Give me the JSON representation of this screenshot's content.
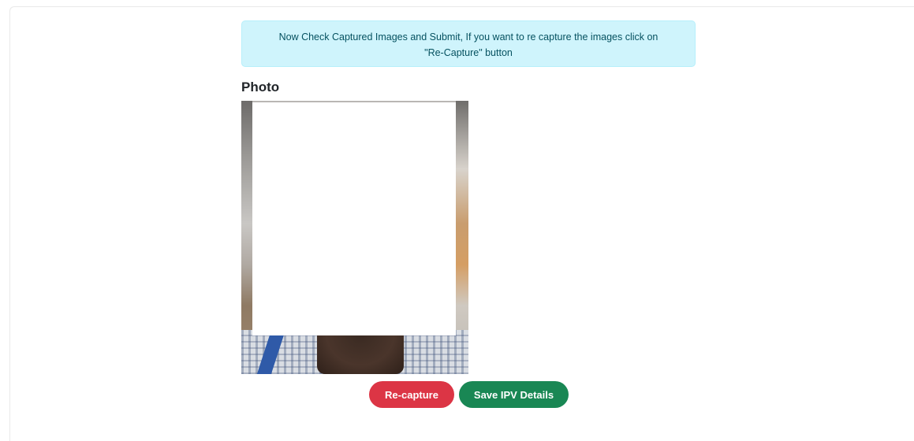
{
  "alert": {
    "line1": "Now Check Captured Images and Submit, If you want to re capture the images click on",
    "line2": "\"Re-Capture\" button"
  },
  "photo": {
    "label": "Photo"
  },
  "actions": {
    "recapture_label": "Re-capture",
    "save_label": "Save IPV Details"
  },
  "colors": {
    "alert_bg": "#cff4fc",
    "alert_text": "#055160",
    "danger": "#dc3545",
    "success": "#198754"
  }
}
